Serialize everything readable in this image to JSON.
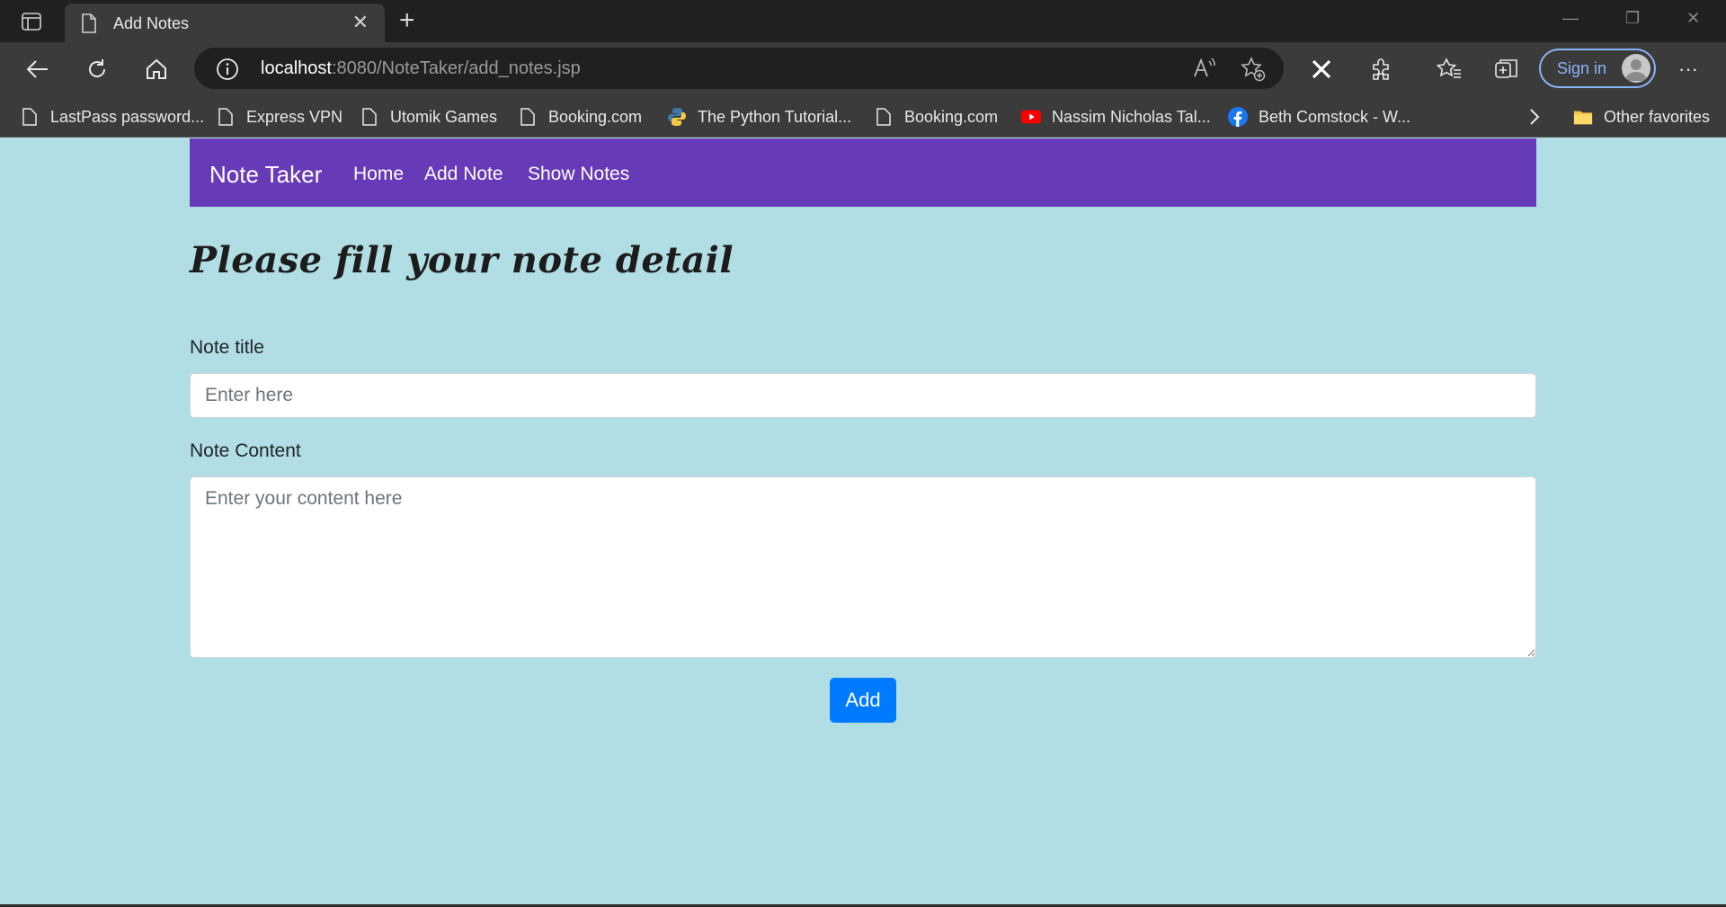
{
  "browser": {
    "tab_title": "Add Notes",
    "new_tab_icon": "plus-icon",
    "url_host": "localhost",
    "url_path": ":8080/NoteTaker/add_notes.jsp",
    "sign_in_label": "Sign in",
    "more_label": "···",
    "bookmarks": [
      {
        "label": "LastPass password...",
        "icon": "page-icon"
      },
      {
        "label": "Express VPN",
        "icon": "page-icon"
      },
      {
        "label": "Utomik Games",
        "icon": "page-icon"
      },
      {
        "label": "Booking.com",
        "icon": "page-icon"
      },
      {
        "label": "The Python Tutorial...",
        "icon": "python-icon"
      },
      {
        "label": "Booking.com",
        "icon": "page-icon"
      },
      {
        "label": "Nassim Nicholas Tal...",
        "icon": "youtube-icon"
      },
      {
        "label": "Beth Comstock - W...",
        "icon": "facebook-icon"
      }
    ],
    "other_favorites_label": "Other favorites"
  },
  "navbar": {
    "brand": "Note Taker",
    "links": [
      "Home",
      "Add Note",
      "Show Notes"
    ],
    "color": "#673ab7"
  },
  "form": {
    "heading": "Please fill your note detail",
    "title_label": "Note title",
    "title_placeholder": "Enter here",
    "title_value": "",
    "content_label": "Note Content",
    "content_placeholder": "Enter your content here",
    "content_value": "",
    "submit_label": "Add",
    "submit_color": "#007bff"
  },
  "page_background": "#b0dee4"
}
